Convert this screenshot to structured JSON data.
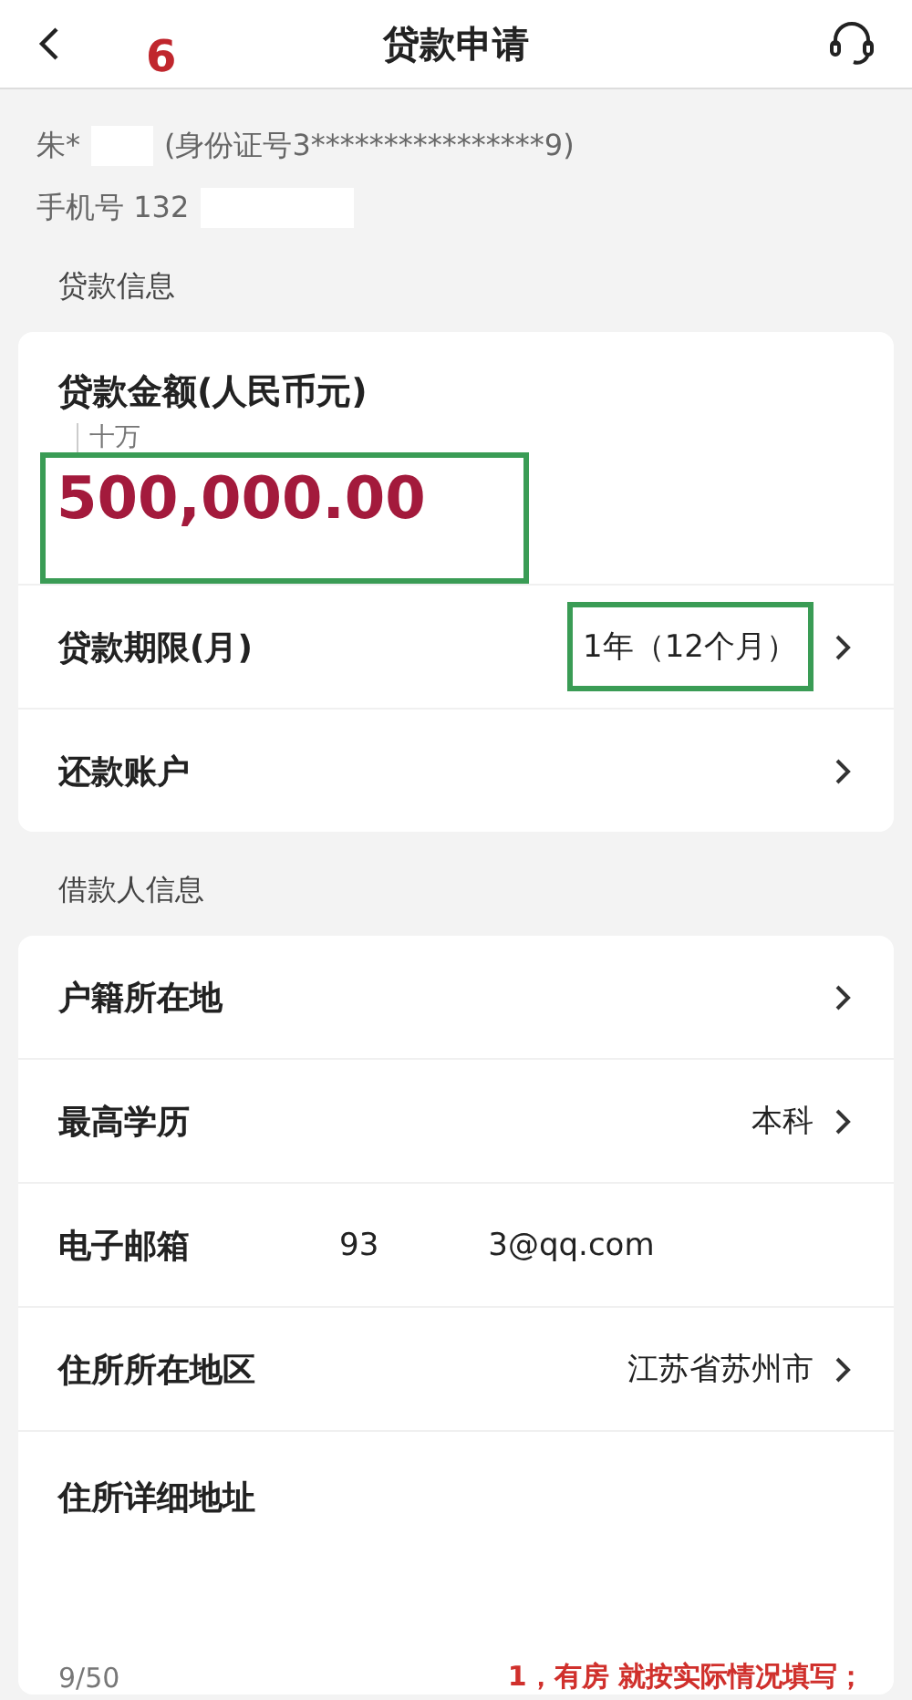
{
  "header": {
    "title": "贷款申请",
    "marker": "6"
  },
  "applicant": {
    "name": "朱*",
    "id_number": "(身份证号3****************9)",
    "phone_label": "手机号 132"
  },
  "loan_section": {
    "title": "贷款信息",
    "amount": {
      "label": "贷款金额(人民币元)",
      "unit_hint": "十万",
      "value": "500,000.00",
      "highlighted": true
    },
    "rows": [
      {
        "label": "贷款期限(月)",
        "value": "1年（12个月）",
        "highlighted": true,
        "chevron": true
      },
      {
        "label": "还款账户",
        "chevron": true
      }
    ]
  },
  "borrower_section": {
    "title": "借款人信息",
    "rows": [
      {
        "label": "户籍所在地",
        "chevron": true
      },
      {
        "label": "最高学历",
        "value": "本科",
        "chevron": true
      },
      {
        "label": "电子邮箱",
        "value_start": "93",
        "value_end": "3@qq.com",
        "chevron": false
      },
      {
        "label": "住所所在地区",
        "value": "江苏省苏州市",
        "chevron": true
      }
    ],
    "address": {
      "label": "住所详细地址",
      "counter": "9/50"
    }
  },
  "note": "1，有房 就按实际情况填写；"
}
